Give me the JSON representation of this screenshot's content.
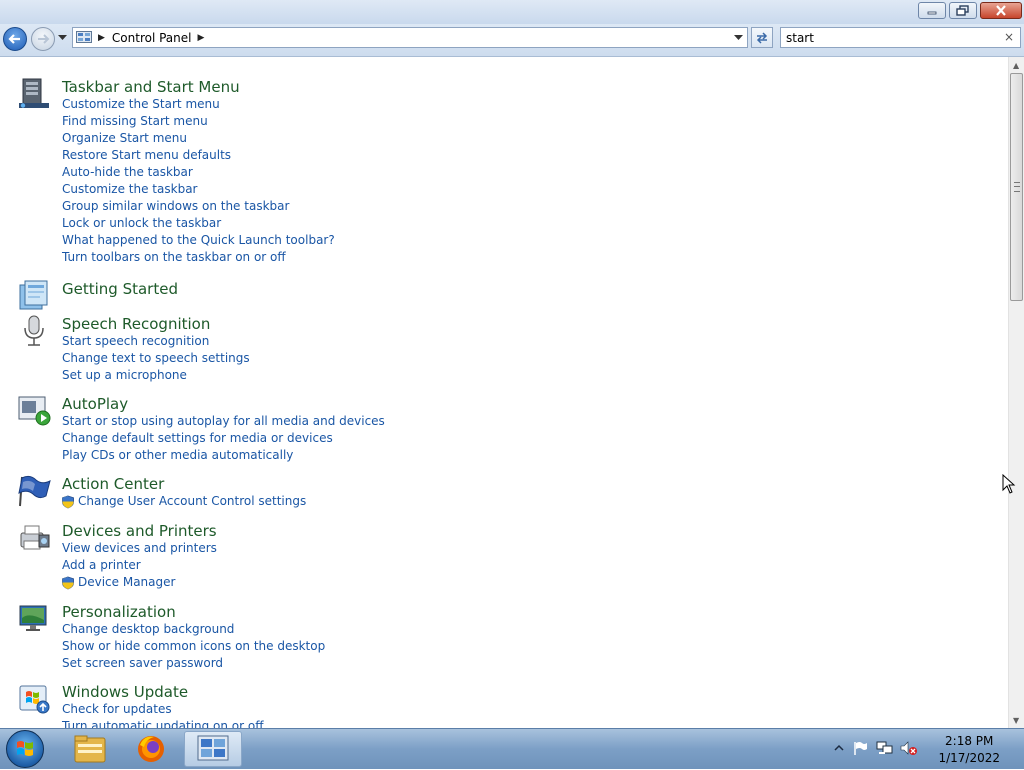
{
  "window": {
    "address": {
      "crumb": "Control Panel"
    },
    "search": {
      "value": "start",
      "clear_glyph": "×"
    }
  },
  "sections": [
    {
      "title": "Taskbar and Start Menu",
      "icon": "taskbar-icon",
      "links": [
        {
          "label": "Customize the Start menu"
        },
        {
          "label": "Find missing Start menu"
        },
        {
          "label": "Organize Start menu"
        },
        {
          "label": "Restore Start menu defaults"
        },
        {
          "label": "Auto-hide the taskbar"
        },
        {
          "label": "Customize the taskbar"
        },
        {
          "label": "Group similar windows on the taskbar"
        },
        {
          "label": "Lock or unlock the taskbar"
        },
        {
          "label": "What happened to the Quick Launch toolbar?"
        },
        {
          "label": "Turn toolbars on the taskbar on or off"
        }
      ]
    },
    {
      "title": "Getting Started",
      "icon": "getting-started-icon",
      "links": []
    },
    {
      "title": "Speech Recognition",
      "icon": "microphone-icon",
      "links": [
        {
          "label": "Start speech recognition"
        },
        {
          "label": "Change text to speech settings"
        },
        {
          "label": "Set up a microphone"
        }
      ]
    },
    {
      "title": "AutoPlay",
      "icon": "autoplay-icon",
      "links": [
        {
          "label": "Start or stop using autoplay for all media and devices"
        },
        {
          "label": "Change default settings for media or devices"
        },
        {
          "label": "Play CDs or other media automatically"
        }
      ]
    },
    {
      "title": "Action Center",
      "icon": "action-center-flag-icon",
      "links": [
        {
          "label": "Change User Account Control settings",
          "shield": true
        }
      ]
    },
    {
      "title": "Devices and Printers",
      "icon": "devices-printers-icon",
      "links": [
        {
          "label": "View devices and printers"
        },
        {
          "label": "Add a printer"
        },
        {
          "label": "Device Manager",
          "shield": true
        }
      ]
    },
    {
      "title": "Personalization",
      "icon": "personalization-icon",
      "links": [
        {
          "label": "Change desktop background"
        },
        {
          "label": "Show or hide common icons on the desktop"
        },
        {
          "label": "Set screen saver password"
        }
      ]
    },
    {
      "title": "Windows Update",
      "icon": "windows-update-icon",
      "links": [
        {
          "label": "Check for updates"
        },
        {
          "label": "Turn automatic updating on or off"
        }
      ]
    }
  ],
  "taskbar": {
    "clock": {
      "time": "2:18 PM",
      "date": "1/17/2022"
    },
    "items": [
      "windows-explorer-icon",
      "firefox-icon",
      "control-panel-icon"
    ]
  },
  "colors": {
    "link": "#1a56a5",
    "section_title": "#1e5a2a",
    "taskbar": "#7c9fc6"
  }
}
